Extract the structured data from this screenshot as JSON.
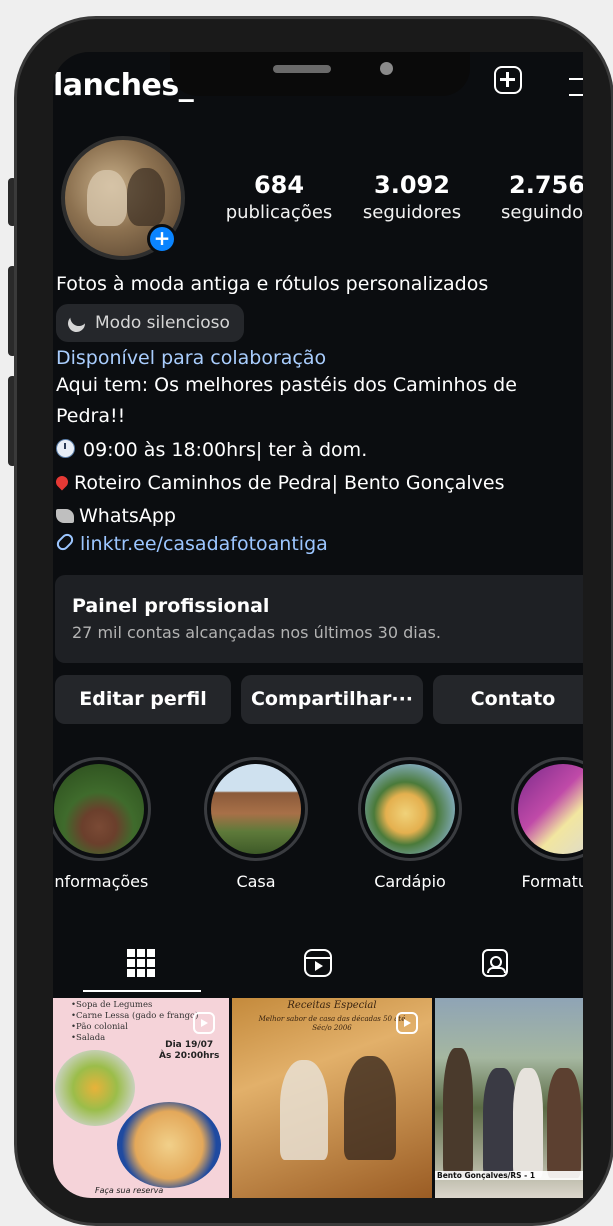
{
  "profile": {
    "username": "lanches_",
    "stats": [
      {
        "value": "684",
        "label": "publicações"
      },
      {
        "value": "3.092",
        "label": "seguidores"
      },
      {
        "value": "2.756",
        "label": "seguindo"
      }
    ]
  },
  "bio": {
    "category": "Fotos à moda antiga e rótulos personalizados",
    "silent_mode": "Modo silencioso",
    "availability": "Disponível para colaboração",
    "line1": "Aqui tem: Os melhores pastéis dos Caminhos de",
    "line2": "Pedra!!",
    "hours": "09:00 às 18:00hrs| ter à dom.",
    "location": "Roteiro Caminhos de Pedra| Bento Gonçalves",
    "whatsapp": "WhatsApp",
    "link": "linktr.ee/casadafotoantiga"
  },
  "panel": {
    "title": "Painel profissional",
    "subtitle": "27 mil contas alcançadas nos últimos 30 dias."
  },
  "actions": {
    "edit": "Editar perfil",
    "share": "Compartilhar···",
    "contact": "Contato"
  },
  "highlights": [
    {
      "label": "Informações"
    },
    {
      "label": "Casa"
    },
    {
      "label": "Cardápio"
    },
    {
      "label": "Formatura"
    }
  ],
  "tabs": [
    "grid-icon",
    "reels-icon",
    "tagged-icon"
  ],
  "posts": {
    "p1": {
      "menu": "•Sopa de Legumes\n•Carne Lessa (gado e frango)\n•Pão colonial\n•Salada",
      "date": "Dia 19/07\nÀs 20:00hrs",
      "footer": "Faça sua reserva"
    },
    "p2": {
      "title": "Receitas Especial",
      "subtitle": "Melhor sabor de casa das décadas 50 até\nSéc/o 2006"
    },
    "p3": {
      "caption": "Bento Gonçalves/RS - 1"
    }
  }
}
